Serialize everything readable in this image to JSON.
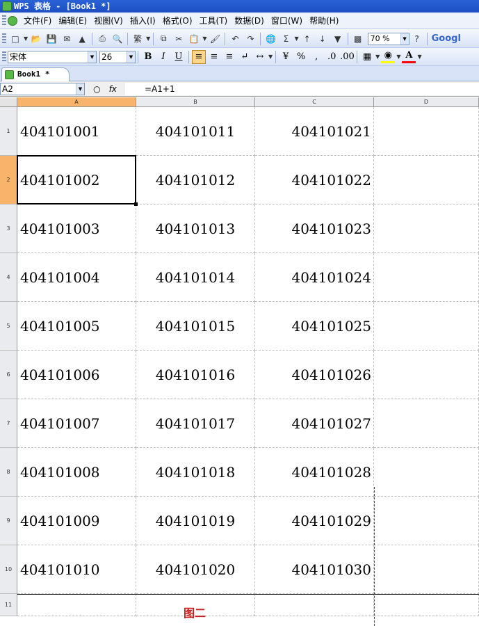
{
  "title_bar": {
    "text": "WPS 表格 - [Book1 *]"
  },
  "menu": {
    "items": [
      "文件(F)",
      "编辑(E)",
      "视图(V)",
      "插入(I)",
      "格式(O)",
      "工具(T)",
      "数据(D)",
      "窗口(W)",
      "帮助(H)"
    ]
  },
  "toolbar": {
    "zoom": "70 %",
    "font_name": "宋体",
    "font_size": "26",
    "traditional_label": "繁",
    "sum_label": "Σ",
    "percent_label": "%",
    "google_label": "Googl",
    "bold_label": "B",
    "italic_label": "I",
    "underline_label": "U",
    "font_color_label": "A",
    "colors": {
      "font_color": "#ff0000",
      "fill_color": "#ffff00"
    }
  },
  "tabs": {
    "active": "Book1 *"
  },
  "formula_bar": {
    "name_box": "A2",
    "formula": "=A1+1",
    "fx_label": "fx"
  },
  "sheet": {
    "columns": [
      "A",
      "B",
      "C",
      "D"
    ],
    "rows": [
      "1",
      "2",
      "3",
      "4",
      "5",
      "6",
      "7",
      "8",
      "9",
      "10",
      "11"
    ],
    "selected_cell": "A2",
    "values": {
      "A": [
        "404101001",
        "404101002",
        "404101003",
        "404101004",
        "404101005",
        "404101006",
        "404101007",
        "404101008",
        "404101009",
        "404101010"
      ],
      "B": [
        "404101011",
        "404101012",
        "404101013",
        "404101014",
        "404101015",
        "404101016",
        "404101017",
        "404101018",
        "404101019",
        "404101020"
      ],
      "C": [
        "404101021",
        "404101022",
        "404101023",
        "404101024",
        "404101025",
        "404101026",
        "404101027",
        "404101028",
        "404101029",
        "404101030"
      ]
    },
    "caption": "图二"
  }
}
